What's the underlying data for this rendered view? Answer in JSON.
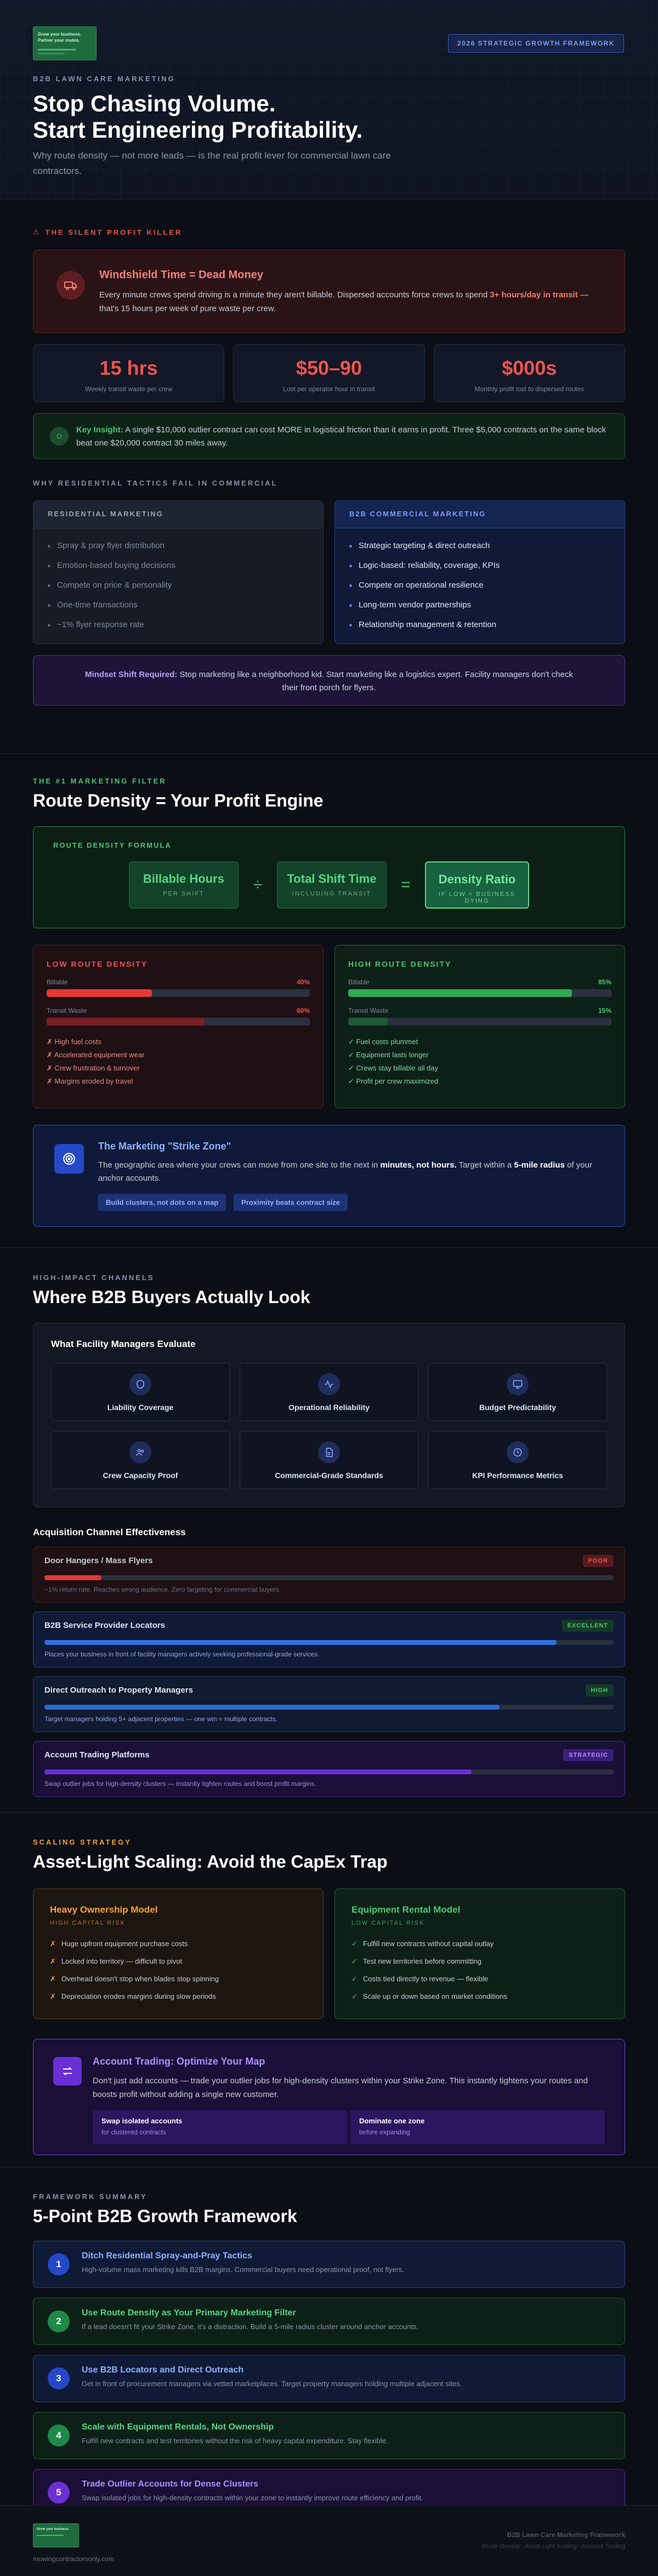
{
  "hero": {
    "logo_line1": "Grow your business.",
    "logo_line2": "Partner your routes.",
    "badge": "2026 STRATEGIC GROWTH FRAMEWORK",
    "eyebrow": "B2B LAWN CARE MARKETING",
    "title_line1": "Stop Chasing Volume.",
    "title_line2": "Start Engineering Profitability.",
    "subtitle": "Why route density — not more leads — is the real profit lever for commercial lawn care contractors."
  },
  "profit_killer": {
    "eyebrow": "THE SILENT PROFIT KILLER",
    "alert_title": "Windshield Time = Dead Money",
    "alert_text_pre": "Every minute crews spend driving is a minute they aren't billable. Dispersed accounts force crews to spend ",
    "alert_text_bold": "3+ hours/day in transit",
    "alert_text_post": " — that's 15 hours per week of pure waste per crew.",
    "stats": [
      {
        "value": "15 hrs",
        "caption": "Weekly transit waste per crew"
      },
      {
        "value": "$50–90",
        "caption": "Lost per operator hour in transit"
      },
      {
        "value": "$000s",
        "caption": "Monthly profit lost to dispersed routes"
      }
    ],
    "insight_bold": "Key Insight:",
    "insight_text": " A single $10,000 outlier contract can cost MORE in logistical friction than it earns in profit. Three $5,000 contracts on the same block beat one $20,000 contract 30 miles away."
  },
  "why": {
    "eyebrow": "WHY RESIDENTIAL TACTICS FAIL IN COMMERCIAL",
    "residential": {
      "title": "RESIDENTIAL MARKETING",
      "items": [
        "Spray & pray flyer distribution",
        "Emotion-based buying decisions",
        "Compete on price & personality",
        "One-time transactions",
        "~1% flyer response rate"
      ]
    },
    "b2b": {
      "title": "B2B COMMERCIAL MARKETING",
      "items": [
        "Strategic targeting & direct outreach",
        "Logic-based: reliability, coverage, KPIs",
        "Compete on operational resilience",
        "Long-term vendor partnerships",
        "Relationship management & retention"
      ]
    },
    "mindset_bold": "Mindset Shift Required:",
    "mindset_text": " Stop marketing like a neighborhood kid. Start marketing like a logistics expert. Facility managers don't check their front porch for flyers."
  },
  "route": {
    "eyebrow": "THE #1 MARKETING FILTER",
    "title": "Route Density = Your Profit Engine",
    "formula_title": "ROUTE DENSITY FORMULA",
    "box1_title": "Billable Hours",
    "box1_sub": "PER SHIFT",
    "op1": "÷",
    "box2_title": "Total Shift Time",
    "box2_sub": "INCLUDING TRANSIT",
    "op2": "=",
    "box3_title": "Density Ratio",
    "box3_sub": "IF LOW = BUSINESS DYING",
    "low": {
      "title": "LOW ROUTE DENSITY",
      "billable_label": "Billable",
      "billable_pct_text": "40%",
      "billable_pct": 40,
      "transit_label": "Transit Waste",
      "transit_pct_text": "60%",
      "transit_pct": 60,
      "items": [
        "✗ High fuel costs",
        "✗ Accelerated equipment wear",
        "✗ Crew frustration & turnover",
        "✗ Margins eroded by travel"
      ]
    },
    "high": {
      "title": "HIGH ROUTE DENSITY",
      "billable_label": "Billable",
      "billable_pct_text": "85%",
      "billable_pct": 85,
      "transit_label": "Transit Waste",
      "transit_pct_text": "15%",
      "transit_pct": 15,
      "items": [
        "✓ Fuel costs plummet",
        "✓ Equipment lasts longer",
        "✓ Crews stay billable all day",
        "✓ Profit per crew maximized"
      ]
    },
    "strike_title": "The Marketing \"Strike Zone\"",
    "strike_text_pre": "The geographic area where your crews can move from one site to the next in ",
    "strike_text_b1": "minutes, not hours.",
    "strike_text_mid": " Target within a ",
    "strike_text_b2": "5-mile radius",
    "strike_text_post": " of your anchor accounts.",
    "pill1": "Build clusters, not dots on a map",
    "pill2": "Proximity beats contract size"
  },
  "channels": {
    "eyebrow": "HIGH-IMPACT CHANNELS",
    "title": "Where B2B Buyers Actually Look",
    "eval_title": "What Facility Managers Evaluate",
    "eval_items": [
      "Liability Coverage",
      "Operational Reliability",
      "Budget Predictability",
      "Crew Capacity Proof",
      "Commercial-Grade Standards",
      "KPI Performance Metrics"
    ],
    "acq_title": "Acquisition Channel Effectiveness",
    "list": [
      {
        "name": "Door Hangers / Mass Flyers",
        "badge": "POOR",
        "score": 10,
        "desc": "~1% return rate. Reaches wrong audience. Zero targeting for commercial buyers."
      },
      {
        "name": "B2B Service Provider Locators",
        "badge": "EXCELLENT",
        "score": 90,
        "desc": "Places your business in front of facility managers actively seeking professional-grade services."
      },
      {
        "name": "Direct Outreach to Property Managers",
        "badge": "HIGH",
        "score": 80,
        "desc": "Target managers holding 5+ adjacent properties — one win = multiple contracts."
      },
      {
        "name": "Account Trading Platforms",
        "badge": "STRATEGIC",
        "score": 75,
        "desc": "Swap outlier jobs for high-density clusters — instantly tighten routes and boost profit margins."
      }
    ]
  },
  "scaling": {
    "eyebrow": "SCALING STRATEGY",
    "title": "Asset-Light Scaling: Avoid the CapEx Trap",
    "heavy": {
      "title": "Heavy Ownership Model",
      "sub": "HIGH CAPITAL RISK",
      "items": [
        "Huge upfront equipment purchase costs",
        "Locked into territory — difficult to pivot",
        "Overhead doesn't stop when blades stop spinning",
        "Depreciation erodes margins during slow periods"
      ]
    },
    "rent": {
      "title": "Equipment Rental Model",
      "sub": "LOW CAPITAL RISK",
      "items": [
        "Fulfill new contracts without capital outlay",
        "Test new territories before committing",
        "Costs tied directly to revenue — flexible",
        "Scale up or down based on market conditions"
      ]
    },
    "acct_title": "Account Trading: Optimize Your Map",
    "acct_text": "Don't just add accounts — trade your outlier jobs for high-density clusters within your Strike Zone. This instantly tightens your routes and boosts profit without adding a single new customer.",
    "card1_title": "Swap isolated accounts",
    "card1_sub": "for clustered contracts",
    "card2_title": "Dominate one zone",
    "card2_sub": "before expanding"
  },
  "framework": {
    "eyebrow": "FRAMEWORK SUMMARY",
    "title": "5-Point B2B Growth Framework",
    "steps": [
      {
        "num": "1",
        "title": "Ditch Residential Spray-and-Pray Tactics",
        "desc": "High-volume mass marketing kills B2B margins. Commercial buyers need operational proof, not flyers."
      },
      {
        "num": "2",
        "title": "Use Route Density as Your Primary Marketing Filter",
        "desc": "If a lead doesn't fit your Strike Zone, it's a distraction. Build a 5-mile radius cluster around anchor accounts."
      },
      {
        "num": "3",
        "title": "Use B2B Locators and Direct Outreach",
        "desc": "Get in front of procurement managers via vetted marketplaces. Target property managers holding multiple adjacent sites."
      },
      {
        "num": "4",
        "title": "Scale with Equipment Rentals, Not Ownership",
        "desc": "Fulfill new contracts and test territories without the risk of heavy capital expenditure. Stay flexible."
      },
      {
        "num": "5",
        "title": "Trade Outlier Accounts for Dense Clusters",
        "desc": "Swap isolated jobs for high-density contracts within your zone to instantly improve route efficiency and profit."
      }
    ]
  },
  "footer": {
    "logo_line": "Grow your business.",
    "url": "mowingcontractorsonly.com",
    "right1": "B2B Lawn Care Marketing Framework",
    "right2": "Route Density · Asset-Light Scaling · Account Trading"
  },
  "colors": {
    "accent_red": "#ef5350",
    "accent_green": "#4cc574",
    "accent_blue": "#5a80e8",
    "accent_purple": "#8b5cf6",
    "accent_orange": "#f2a23c"
  }
}
